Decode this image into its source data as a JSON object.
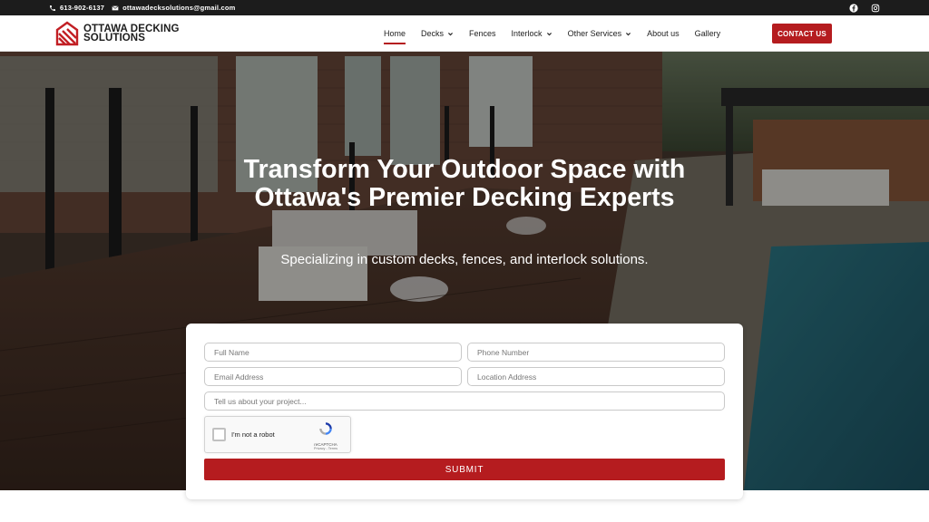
{
  "topbar": {
    "phone": "613-902-6137",
    "email": "ottawadecksolutions@gmail.com",
    "social_icons": [
      "facebook-icon",
      "instagram-icon"
    ]
  },
  "header": {
    "logo_line1": "OTTAWA DECKING",
    "logo_line2": "SOLUTIONS",
    "nav": [
      {
        "label": "Home",
        "active": true,
        "dropdown": false
      },
      {
        "label": "Decks",
        "dropdown": true
      },
      {
        "label": "Fences",
        "dropdown": false
      },
      {
        "label": "Interlock",
        "dropdown": true
      },
      {
        "label": "Other Services",
        "dropdown": true
      },
      {
        "label": "About us",
        "dropdown": false
      },
      {
        "label": "Gallery",
        "dropdown": false
      }
    ],
    "cta_label": "CONTACT US"
  },
  "hero": {
    "title": "Transform Your Outdoor Space with Ottawa's Premier Decking Experts",
    "subtitle": "Specializing in custom decks, fences, and interlock solutions."
  },
  "form": {
    "full_name_placeholder": "Full Name",
    "phone_placeholder": "Phone Number",
    "email_placeholder": "Email Address",
    "location_placeholder": "Location Address",
    "project_placeholder": "Tell us about your project...",
    "recaptcha_label": "I'm not a robot",
    "recaptcha_brand": "reCAPTCHA",
    "recaptcha_links": "Privacy - Terms",
    "submit_label": "SUBMIT"
  },
  "colors": {
    "accent": "#b51c1f",
    "topbar": "#1c1c1c"
  }
}
